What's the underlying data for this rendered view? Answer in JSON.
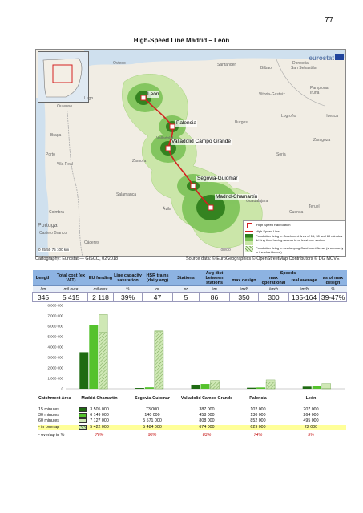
{
  "page_number": "77",
  "title": "High-Speed Line Madrid – León",
  "map": {
    "eurostat_label": "eurostat",
    "scale_label": "0   25   50   75   100 km",
    "stations": [
      "León",
      "Palencia",
      "Valladolid Campo Grande",
      "Segovia-Guiomar",
      "Madrid-Chamartín"
    ],
    "place_labels": [
      "Oviedo",
      "Santander",
      "Bilbao",
      "Donostia",
      "San Sebastián",
      "Vitoria-Gasteiz",
      "Pamplona",
      "Iruña",
      "Logroño",
      "Burgos",
      "Ourense",
      "Braga",
      "Porto",
      "Vila Real",
      "Salamanca",
      "Zamora",
      "Ávila",
      "Toledo",
      "Cuenca",
      "Guadalajara",
      "Teruel",
      "Soria",
      "Zaragoza",
      "Coimbra",
      "Castelo Branco",
      "Cáceres",
      "Huesca",
      "Portugal",
      "Lugo",
      "Valladolid"
    ],
    "legend": [
      "High Speed Rail Station",
      "High Speed Line",
      "Population living in Catchment Area of 15, 30 and 60 minutes driving time having access to at least one station",
      "Population living in overlapping Catchment Areas (shown only in the chart below)"
    ],
    "credit_left": "Cartography: Eurostat — GISCO, 02/2018",
    "credit_right": "Source data: © EuroGeographics © OpenStreetMap Contributors © DG MOVE",
    "colors": {
      "line": "#d42020",
      "zone15": "#2e7d1b",
      "zone30": "#63b13a",
      "zone60": "#b7df8e"
    }
  },
  "stats_table": {
    "headers": [
      "Length",
      "Total cost (ex VAT)",
      "EU funding",
      "Line capacity saturation",
      "HSR trains (daily avg)",
      "Stations",
      "Avg dist between stations",
      "Speeds",
      "max design",
      "max operational",
      "real average",
      "as of max design"
    ],
    "units": [
      "km",
      "mil euro",
      "mil euro",
      "%",
      "nr",
      "nr",
      "km",
      "km/h",
      "km/h",
      "km/h",
      "%"
    ],
    "values": [
      "345",
      "5 415",
      "2 118",
      "39%",
      "47",
      "5",
      "86",
      "350",
      "300",
      "135-164",
      "39-47%"
    ]
  },
  "chart_data": {
    "type": "bar",
    "categories": [
      "Madrid-Chamartín",
      "Segovia-Guiomar",
      "Valladolid Campo Grande",
      "Palencia",
      "León"
    ],
    "series": [
      {
        "name": "15 minutes",
        "values": [
          3505000,
          73000,
          387000,
          102000,
          207000
        ]
      },
      {
        "name": "30 minutes",
        "values": [
          6149000,
          140000,
          458000,
          130000,
          264000
        ]
      },
      {
        "name": "60 minutes",
        "values": [
          7127000,
          5571000,
          808000,
          852000,
          495000
        ]
      }
    ],
    "overlap_values": [
      5422000,
      5484000,
      674000,
      629000,
      22000
    ],
    "yticks": [
      "0",
      "1 000 000",
      "2 000 000",
      "3 000 000",
      "4 000 000",
      "5 000 000",
      "6 000 000",
      "7 000 000",
      "8 000 000"
    ],
    "ylim": [
      0,
      8000000
    ],
    "grid": false,
    "colors": {
      "s15": "#1f6b12",
      "s30": "#55c22d",
      "s60": "#cfe8b5",
      "hatch": "#7aa85a",
      "overlap": "#b9e08c"
    }
  },
  "catchment_table": {
    "header": "Catchment Area",
    "stations": [
      "Madrid-Chamartín",
      "Segovia-Guiomar",
      "Valladolid Campo Grande",
      "Palencia",
      "León"
    ],
    "rows": [
      {
        "label": "15 minutes",
        "values": [
          "3 505 000",
          "73 000",
          "387 000",
          "102 000",
          "207 000"
        ]
      },
      {
        "label": "30 minutes",
        "values": [
          "6 149 000",
          "140 000",
          "458 000",
          "130 000",
          "264 000"
        ]
      },
      {
        "label": "60 minutes",
        "values": [
          "7 127 000",
          "5 571 000",
          "808 000",
          "852 000",
          "495 000"
        ]
      },
      {
        "label": "- in overlap",
        "values": [
          "5 422 000",
          "5 484 000",
          "674 000",
          "629 000",
          "22 000"
        ]
      },
      {
        "label": "- overlap in %",
        "values": [
          "76%",
          "98%",
          "83%",
          "74%",
          "5%"
        ]
      }
    ]
  }
}
